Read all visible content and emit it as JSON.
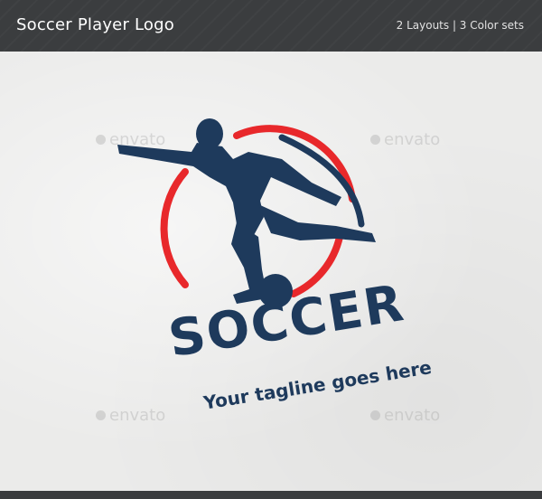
{
  "header": {
    "title": "Soccer Player Logo",
    "meta": "2 Layouts | 3 Color sets"
  },
  "logo": {
    "brand_text": "SOCCER",
    "tagline": "Your tagline goes here",
    "colors": {
      "navy": "#1e3a5c",
      "red": "#e8282b",
      "paper": "#ebebea"
    }
  },
  "watermarks": [
    {
      "text": "envato"
    },
    {
      "text": "envato"
    },
    {
      "text": "envato"
    },
    {
      "text": "envato"
    }
  ]
}
